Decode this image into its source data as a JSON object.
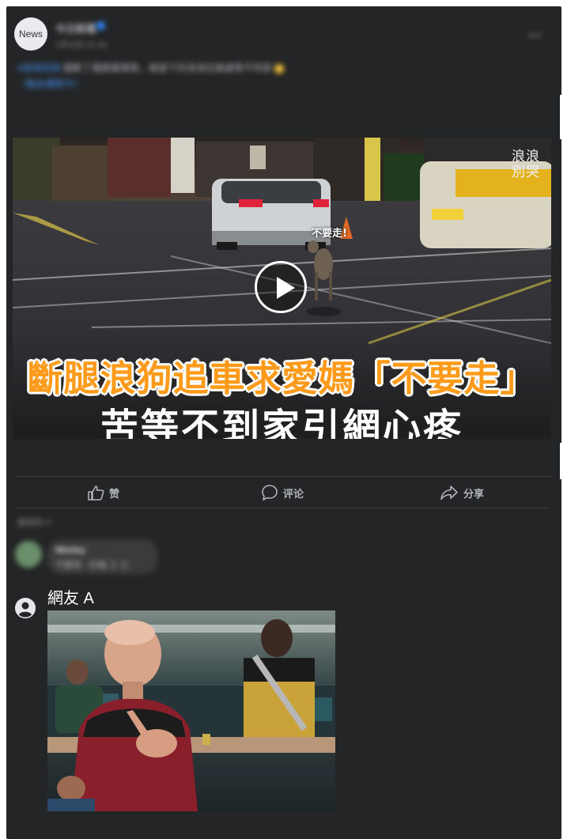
{
  "post": {
    "avatar_label": "News",
    "page_name": "今日新聞",
    "timestamp": "1月18日 21:43",
    "text_tag": "#浪浪別哭",
    "text_body": "腿斷了還跟著車跑，被留下的浪浪在路邊等不到家",
    "text_link": "（點此看影片）",
    "more_icon": "more-dots-icon"
  },
  "video": {
    "brand_mark": "浪浪\n別哭",
    "bubble_text": "不要走!",
    "headline_line1": "斷腿浪狗追車求愛媽「不要走」",
    "headline_line2": "苦等不到家引網心疼"
  },
  "actions": {
    "like_label": "赞",
    "comment_label": "评论",
    "share_label": "分享"
  },
  "comments": {
    "filter_label": "最相关 ▾",
    "first_comment_name": "Wesley",
    "first_comment_text": "不要哭 · 好痛 工 工",
    "commenter_name": "網友 A"
  },
  "colors": {
    "card_bg": "#242526",
    "accent_blue": "#2d88ff",
    "headline_orange": "#ff9a1a"
  }
}
